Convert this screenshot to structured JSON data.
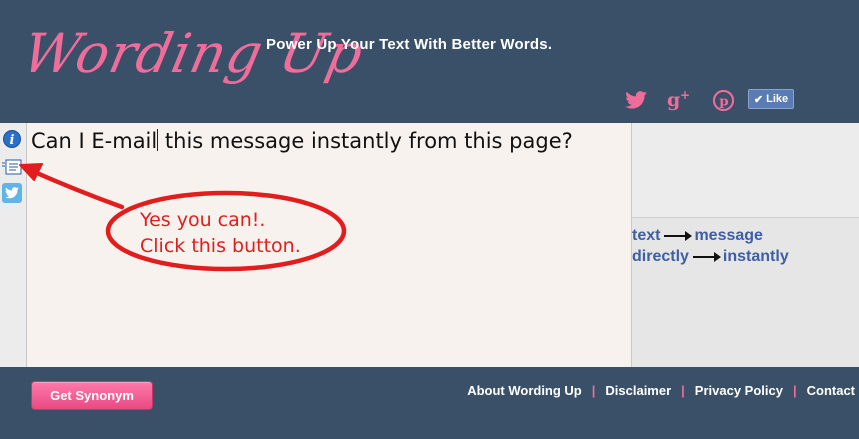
{
  "header": {
    "logo": "Wording Up",
    "tagline": "Power Up Your Text With Better Words.",
    "social": {
      "twitter_icon": "twitter-icon",
      "gplus_icon": "google-plus-icon",
      "pinterest_icon": "pinterest-icon",
      "like_label": "Like"
    }
  },
  "tools": [
    "info-icon",
    "email-icon",
    "twitter-icon"
  ],
  "editor": {
    "text_before_caret": "Can I E-mail",
    "text_after_caret": " this message instantly from this page?"
  },
  "annotation": {
    "line1": "Yes you can!.",
    "line2": "Click this button."
  },
  "synonyms": [
    {
      "from": "text",
      "to": "message"
    },
    {
      "from": "directly",
      "to": "instantly"
    }
  ],
  "footer": {
    "get_synonym_label": "Get Synonym",
    "links": [
      "About Wording Up",
      "Disclaimer",
      "Privacy Policy",
      "Contact"
    ]
  },
  "colors": {
    "header_bg": "#3a5068",
    "accent_pink": "#f06c9b",
    "synonym_blue": "#3e5fa2",
    "annotation_red": "#e21d1d"
  }
}
